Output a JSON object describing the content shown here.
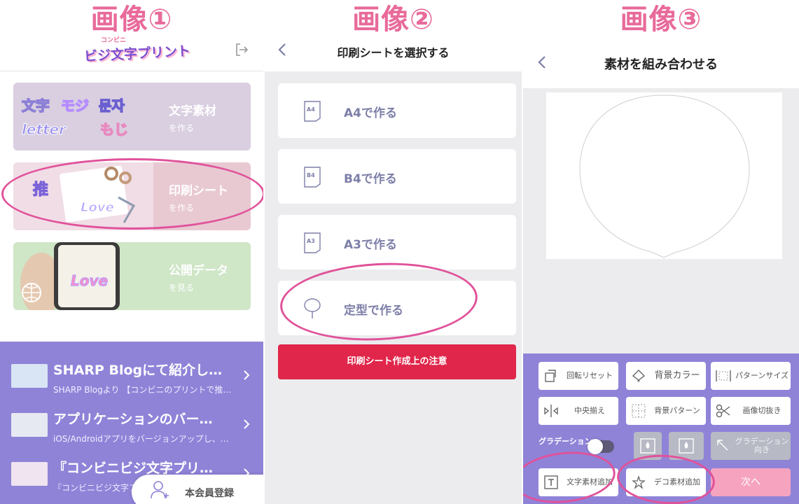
{
  "captions": [
    "画像①",
    "画像②",
    "画像③"
  ],
  "panel1": {
    "logo_text": "ビジ文字プリント",
    "logo_small": "コンビニ",
    "cards": [
      {
        "title": "文字素材",
        "sub": "を作る",
        "art_words": [
          "文字",
          "モジ",
          "문자",
          "letter",
          "もじ"
        ],
        "color": "#d9cfe0"
      },
      {
        "title": "印刷シート",
        "sub": "を作る",
        "art_words": [
          "推",
          "Love"
        ],
        "color": "#e8c9d2"
      },
      {
        "title": "公開データ",
        "sub": "を見る",
        "art_words": [
          "Love"
        ],
        "color": "#cfe6c7"
      }
    ],
    "news": [
      {
        "title": "SHARP Blogにて紹介し…",
        "desc": "SHARP Blogより 【コンビニのプリントで推…"
      },
      {
        "title": "アプリケーションのバー…",
        "desc": "iOS/Androidアプリをバージョンアップし、…"
      },
      {
        "title": "『コンビニビジ文字プリ…",
        "desc": "『コンビニビジ文字プ"
      }
    ],
    "member_label": "本会員登録"
  },
  "panel2": {
    "title": "印刷シートを選択する",
    "options": [
      {
        "label": "A4で作る",
        "icon_text": "A4"
      },
      {
        "label": "B4で作る",
        "icon_text": "B4"
      },
      {
        "label": "A3で作る",
        "icon_text": "A3"
      },
      {
        "label": "定型で作る",
        "icon_text": ""
      }
    ],
    "warning_button": "印刷シート作成上の注意"
  },
  "panel3": {
    "title": "素材を組み合わせる",
    "buttons": {
      "rotate_reset": "回転リセット",
      "bg_color": "背景カラー",
      "pattern_size": "パターンサイズ",
      "center_align": "中央揃え",
      "bg_pattern": "背景パターン",
      "image_crop": "画像切抜き",
      "gradation_dir": "グラデーション向き",
      "add_text": "文字素材追加",
      "add_deco": "デコ素材追加",
      "next": "次へ"
    },
    "gradation_label": "グラデーション",
    "colors": {
      "accent": "#8f83d8",
      "next": "#f6a3c0",
      "highlight": "#e0529a"
    }
  }
}
